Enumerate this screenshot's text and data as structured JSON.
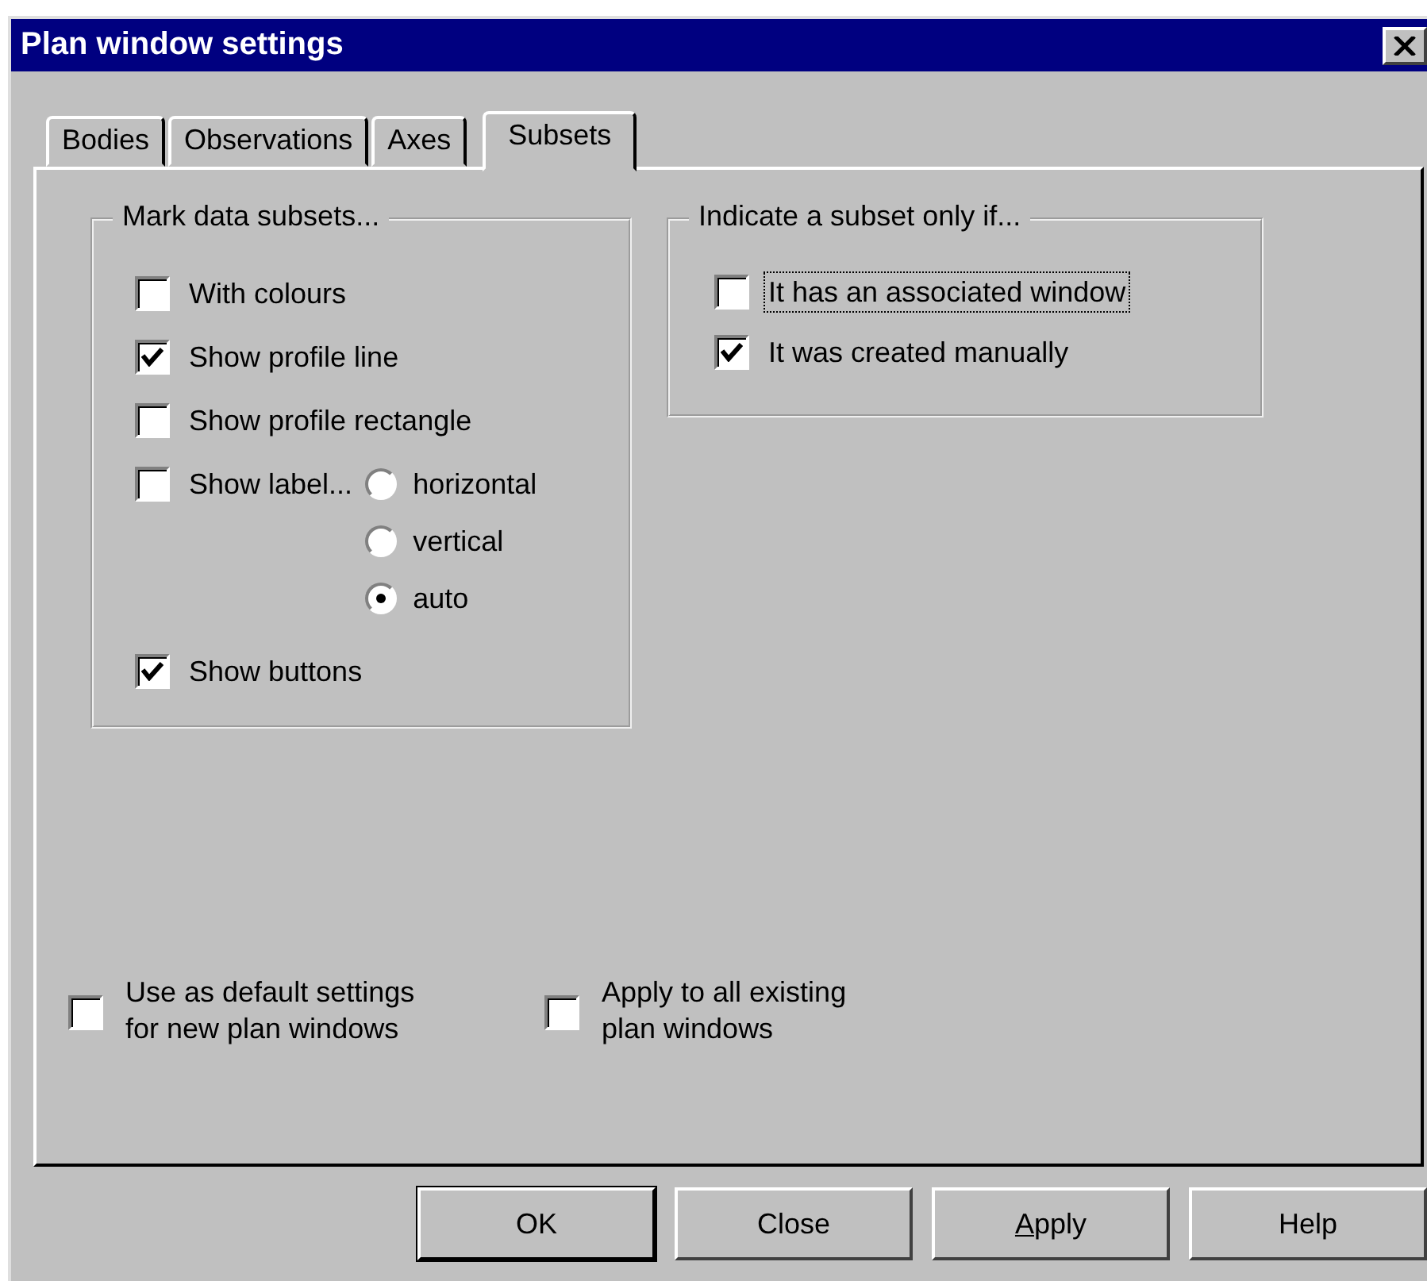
{
  "window": {
    "title": "Plan window settings"
  },
  "tabs": [
    {
      "label": "Bodies",
      "selected": false
    },
    {
      "label": "Observations",
      "selected": false
    },
    {
      "label": "Axes",
      "selected": false
    },
    {
      "label": "Subsets",
      "selected": true
    }
  ],
  "mark_group": {
    "title": "Mark data subsets...",
    "options": [
      {
        "kind": "checkbox",
        "label": "With colours",
        "checked": false
      },
      {
        "kind": "checkbox",
        "label": "Show profile line",
        "checked": true
      },
      {
        "kind": "checkbox",
        "label": "Show profile rectangle",
        "checked": false
      },
      {
        "kind": "checkbox_radios",
        "label": "Show label...",
        "checked": false,
        "radios": [
          {
            "label": "horizontal",
            "selected": false
          },
          {
            "label": "vertical",
            "selected": false
          },
          {
            "label": "auto",
            "selected": true
          }
        ]
      },
      {
        "kind": "checkbox",
        "label": "Show buttons",
        "checked": true
      }
    ]
  },
  "indicate_group": {
    "title": "Indicate a subset only if...",
    "options": [
      {
        "label": "It has an associated window",
        "checked": false,
        "focused": true
      },
      {
        "label": "It was created manually",
        "checked": true,
        "focused": false
      }
    ]
  },
  "defaults": [
    {
      "label": "Use as default settings\nfor new plan windows",
      "checked": false
    },
    {
      "label": "Apply to all existing\nplan windows",
      "checked": false
    }
  ],
  "buttons": [
    {
      "label": "OK",
      "default": true,
      "mnemonic": false
    },
    {
      "label": "Close",
      "default": false,
      "mnemonic": false
    },
    {
      "label": "Apply",
      "default": false,
      "mnemonic": true
    },
    {
      "label": "Help",
      "default": false,
      "mnemonic": false
    }
  ]
}
